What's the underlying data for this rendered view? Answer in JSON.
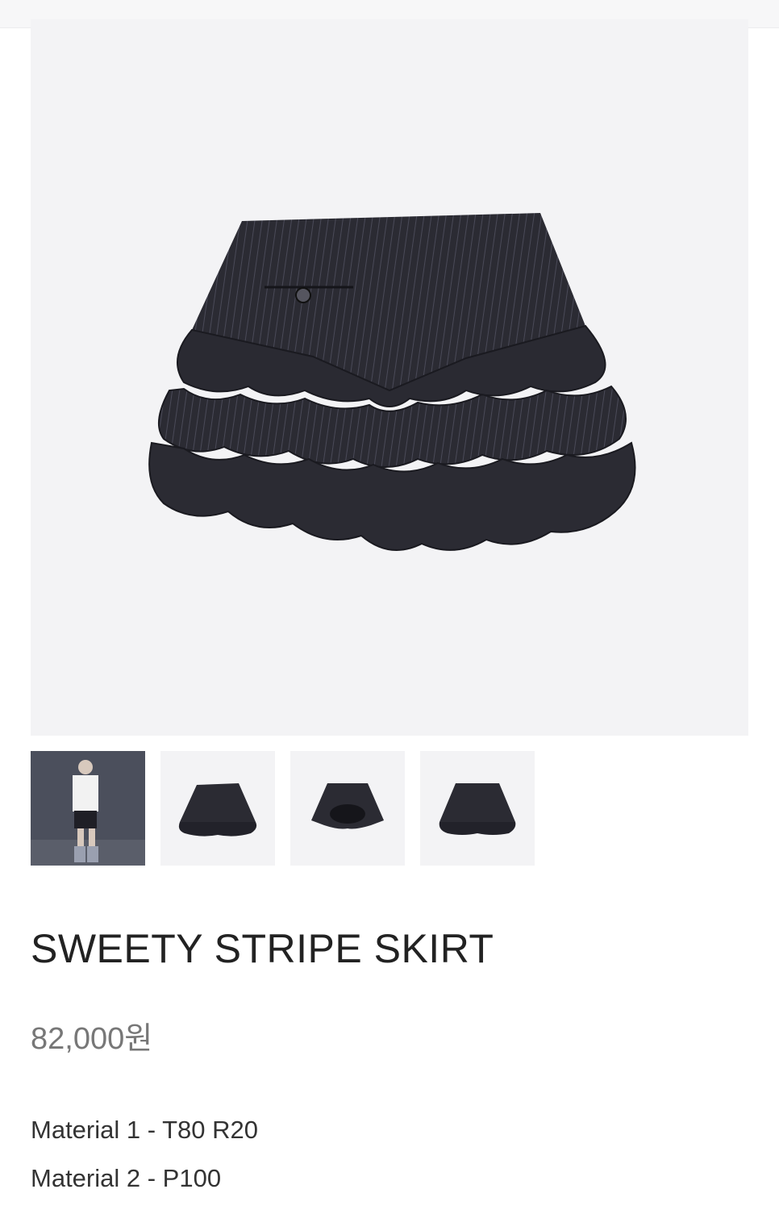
{
  "product": {
    "title": "SWEETY STRIPE SKIRT",
    "price": "82,000원",
    "materials": [
      "Material 1 - T80 R20",
      "Material 2 - P100"
    ]
  },
  "gallery": {
    "main_image": "skirt-front",
    "thumbnails": [
      "model-photo",
      "skirt-front",
      "skirt-back",
      "skirt-side"
    ]
  },
  "colors": {
    "skirt": "#2b2b33",
    "image_bg": "#f3f3f5",
    "price_text": "#777777"
  }
}
